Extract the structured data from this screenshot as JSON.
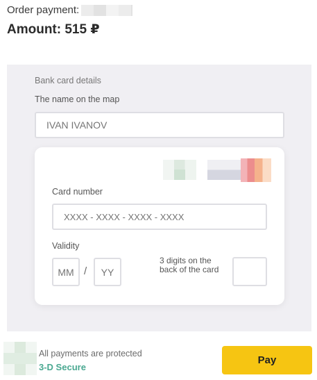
{
  "order": {
    "label": "Order payment:",
    "amount_text": "Amount: 515 ₽"
  },
  "form": {
    "title": "Bank card details",
    "name_label": "The name on the map",
    "name_placeholder": "IVAN IVANOV",
    "card_number_label": "Card number",
    "card_number_placeholder": "XXXX - XXXX - XXXX - XXXX",
    "validity_label": "Validity",
    "month_placeholder": "MM",
    "separator": "/",
    "year_placeholder": "YY",
    "cvv_label": "3 digits on the back of the card"
  },
  "security": {
    "protected_text": "All payments are protected",
    "secure_text": "3-D Secure"
  },
  "actions": {
    "pay_label": "Pay"
  },
  "colors": {
    "pay_button": "#f6c512",
    "secure_text": "#4aa891",
    "panel_bg": "#f0eff3"
  }
}
